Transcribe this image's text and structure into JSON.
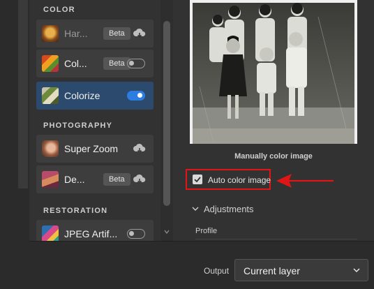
{
  "sections": {
    "color": "COLOR",
    "photography": "PHOTOGRAPHY",
    "restoration": "RESTORATION"
  },
  "filters": {
    "harmonization": {
      "label": "Har...",
      "badge": "Beta",
      "icon": "cloud-download-icon"
    },
    "color_transfer": {
      "label": "Col...",
      "badge": "Beta",
      "enabled": false
    },
    "colorize": {
      "label": "Colorize",
      "enabled": true,
      "active": true
    },
    "super_zoom": {
      "label": "Super Zoom",
      "icon": "cloud-download-icon"
    },
    "depth_blur": {
      "label": "De...",
      "badge": "Beta",
      "icon": "cloud-download-icon"
    },
    "jpeg_artifacts": {
      "label": "JPEG Artif...",
      "enabled": false
    }
  },
  "preview": {
    "caption": "Manually color image"
  },
  "auto_color": {
    "label": "Auto color image",
    "checked": true
  },
  "adjustments": {
    "label": "Adjustments",
    "expanded": false,
    "profile_label": "Profile"
  },
  "output": {
    "label": "Output",
    "value": "Current layer"
  },
  "colors": {
    "accent": "#2d7de1",
    "active_item": "#2c4a6e",
    "highlight": "#e01515"
  }
}
